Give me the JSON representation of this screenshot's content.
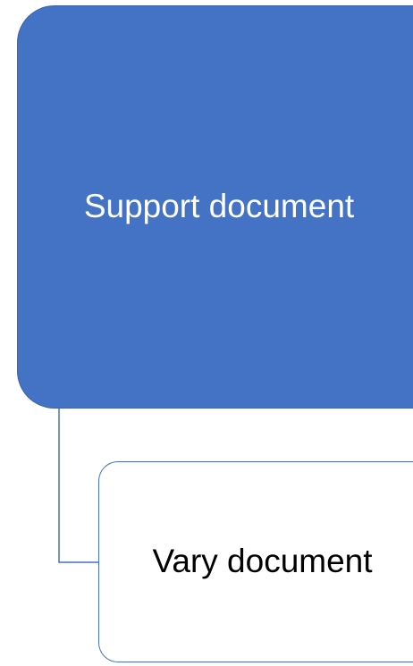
{
  "diagram": {
    "root": {
      "label": "Support document",
      "color": "#4472c4",
      "text_color": "#ffffff"
    },
    "children": [
      {
        "label": "Vary document",
        "border_color": "#4472c4",
        "text_color": "#000000"
      }
    ],
    "connector_color": "#4472c4"
  }
}
